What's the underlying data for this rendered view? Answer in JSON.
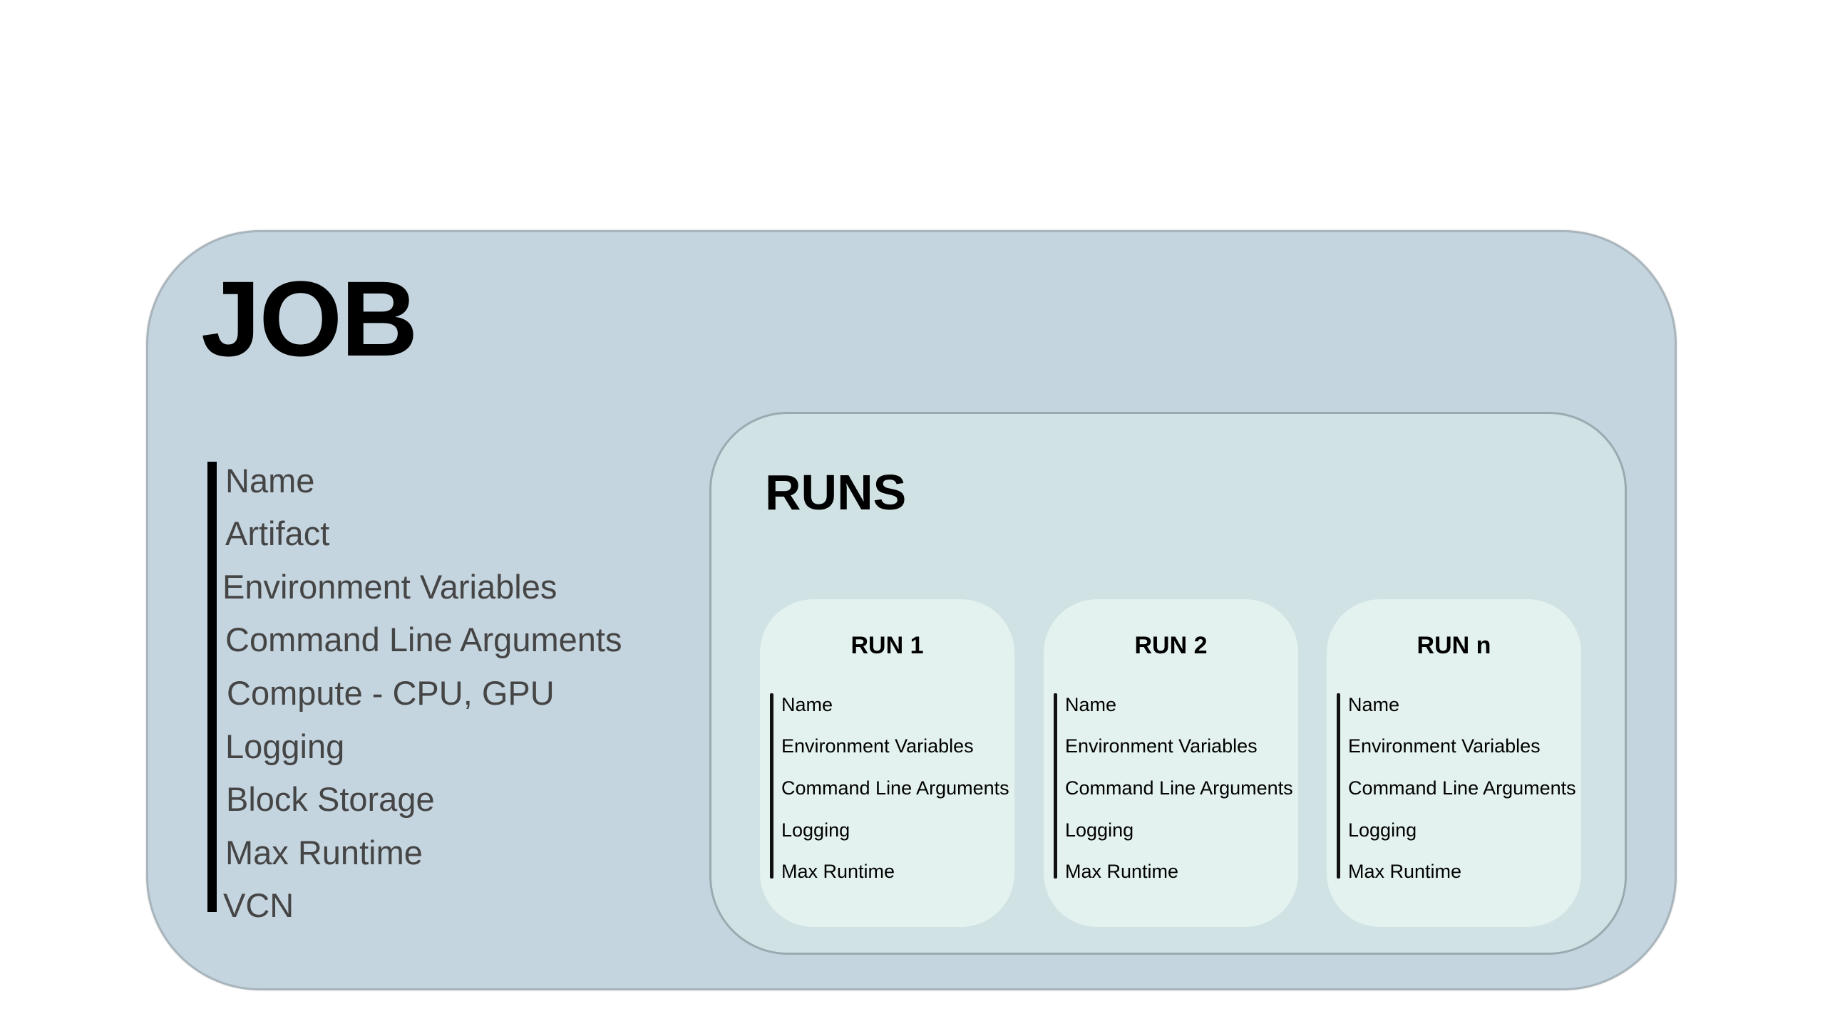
{
  "job": {
    "title": "JOB",
    "items": [
      "Name",
      "Artifact",
      "Environment Variables",
      "Command Line Arguments",
      "Compute - CPU, GPU",
      "Logging",
      "Block Storage",
      "Max Runtime",
      "VCN"
    ]
  },
  "runs": {
    "title": "RUNS",
    "cards": [
      {
        "title": "RUN 1",
        "items": [
          "Name",
          "Environment Variables",
          "Command Line Arguments",
          "Logging",
          "Max Runtime"
        ]
      },
      {
        "title": "RUN 2",
        "items": [
          "Name",
          "Environment Variables",
          "Command Line Arguments",
          "Logging",
          "Max Runtime"
        ]
      },
      {
        "title": "RUN n",
        "items": [
          "Name",
          "Environment Variables",
          "Command Line Arguments",
          "Logging",
          "Max Runtime"
        ]
      }
    ]
  },
  "colors": {
    "job_bg": "#c5d5df",
    "runs_bg": "#d1e2e5",
    "run_card_bg": "#e3f2ee"
  }
}
